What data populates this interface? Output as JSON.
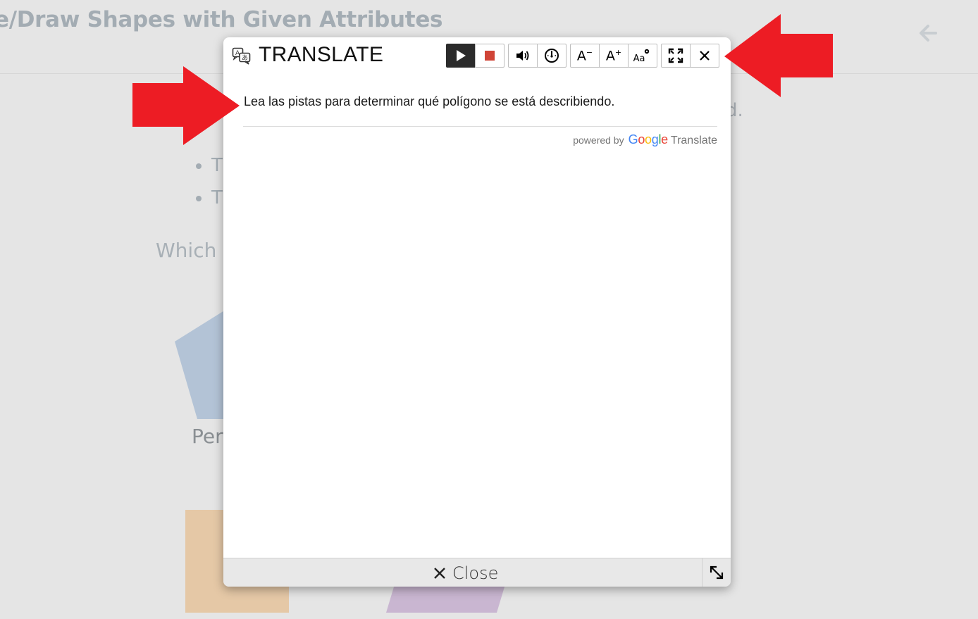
{
  "background": {
    "title": "e/Draw Shapes with Given Attributes",
    "cut_text": "d.",
    "bullets": [
      "T",
      "T"
    ],
    "question_fragment": "Which s",
    "shape_label_fragment": "Per",
    "back_icon": "arrow-left-icon"
  },
  "dialog": {
    "title": "TRANSLATE",
    "title_icon": "translate-icon",
    "toolbar": {
      "play_icon": "play-icon",
      "stop_icon": "stop-icon",
      "volume_icon": "volume-icon",
      "speed_icon": "speedometer-icon",
      "font_decrease": "A",
      "font_decrease_sup": "−",
      "font_increase": "A",
      "font_increase_sup": "+",
      "font_settings": "Aa",
      "fullscreen_icon": "fullscreen-icon",
      "close_icon": "close-icon"
    },
    "translated_text": "Lea las pistas para determinar qué polígono se está describiendo.",
    "powered_by": {
      "prefix": "powered by",
      "g1": "G",
      "g2": "o",
      "g3": "o",
      "g4": "g",
      "g5": "l",
      "g6": "e",
      "product": "Translate"
    },
    "footer": {
      "close_label": "Close",
      "resize_icon": "resize-icon"
    }
  },
  "colors": {
    "arrow": "#ed1c24",
    "stop": "#d04437",
    "google_blue": "#4285f4",
    "google_red": "#ea4335",
    "google_yellow": "#fbbc05",
    "google_green": "#34a853",
    "pentagon": "#b3c3d6",
    "square": "#e5c8a6",
    "parallelogram": "#c9b6d1"
  }
}
